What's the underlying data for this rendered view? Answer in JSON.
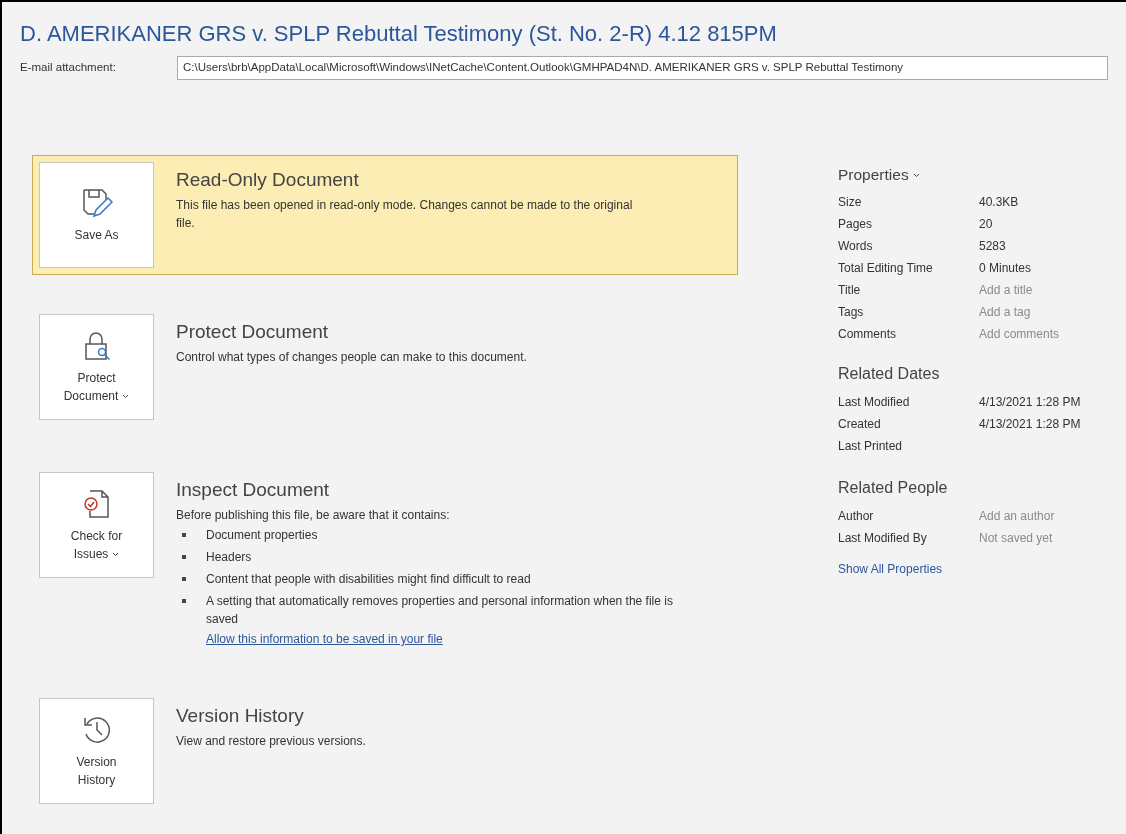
{
  "title": "D. AMERIKANER GRS v. SPLP Rebuttal Testimony (St. No. 2-R) 4.12 815PM",
  "attachment": {
    "label": "E-mail attachment:",
    "value": "C:\\Users\\brb\\AppData\\Local\\Microsoft\\Windows\\INetCache\\Content.Outlook\\GMHPAD4N\\D. AMERIKANER GRS v. SPLP Rebuttal Testimony"
  },
  "sections": [
    {
      "kind": "read_only",
      "highlighted": true,
      "button": {
        "label": "Save As",
        "dropdown": false
      },
      "heading": "Read-Only Document",
      "description": "This file has been opened in read-only mode. Changes cannot be made to the original file."
    },
    {
      "kind": "protect",
      "highlighted": false,
      "button": {
        "label": "Protect Document",
        "dropdown": true
      },
      "heading": "Protect Document",
      "description": "Control what types of changes people can make to this document."
    },
    {
      "kind": "inspect",
      "highlighted": false,
      "button": {
        "label": "Check for Issues",
        "dropdown": true
      },
      "heading": "Inspect Document",
      "description": "Before publishing this file, be aware that it contains:",
      "items": [
        "Document properties",
        "Headers",
        "Content that people with disabilities might find difficult to read",
        "A setting that automatically removes properties and personal information when the file is saved"
      ],
      "link": "Allow this information to be saved in your file"
    },
    {
      "kind": "history",
      "highlighted": false,
      "button": {
        "label": "Version History",
        "dropdown": false
      },
      "heading": "Version History",
      "description": "View and restore previous versions."
    }
  ],
  "properties": {
    "heading": "Properties",
    "dropdown": true,
    "rows": [
      {
        "label": "Size",
        "value": "40.3KB",
        "hint": false
      },
      {
        "label": "Pages",
        "value": "20",
        "hint": false
      },
      {
        "label": "Words",
        "value": "5283",
        "hint": false
      },
      {
        "label": "Total Editing Time",
        "value": "0 Minutes",
        "hint": false
      },
      {
        "label": "Title",
        "value": "Add a title",
        "hint": true
      },
      {
        "label": "Tags",
        "value": "Add a tag",
        "hint": true
      },
      {
        "label": "Comments",
        "value": "Add comments",
        "hint": true
      }
    ]
  },
  "related_dates": {
    "heading": "Related Dates",
    "rows": [
      {
        "label": "Last Modified",
        "value": "4/13/2021 1:28 PM"
      },
      {
        "label": "Created",
        "value": "4/13/2021 1:28 PM"
      },
      {
        "label": "Last Printed"
      }
    ]
  },
  "related_people": {
    "heading": "Related People",
    "rows": [
      {
        "label": "Author",
        "value": "Add an author",
        "hint": true
      },
      {
        "label": "Last Modified By",
        "value": "Not saved yet",
        "hint": true
      }
    ]
  },
  "show_all": "Show All Properties"
}
